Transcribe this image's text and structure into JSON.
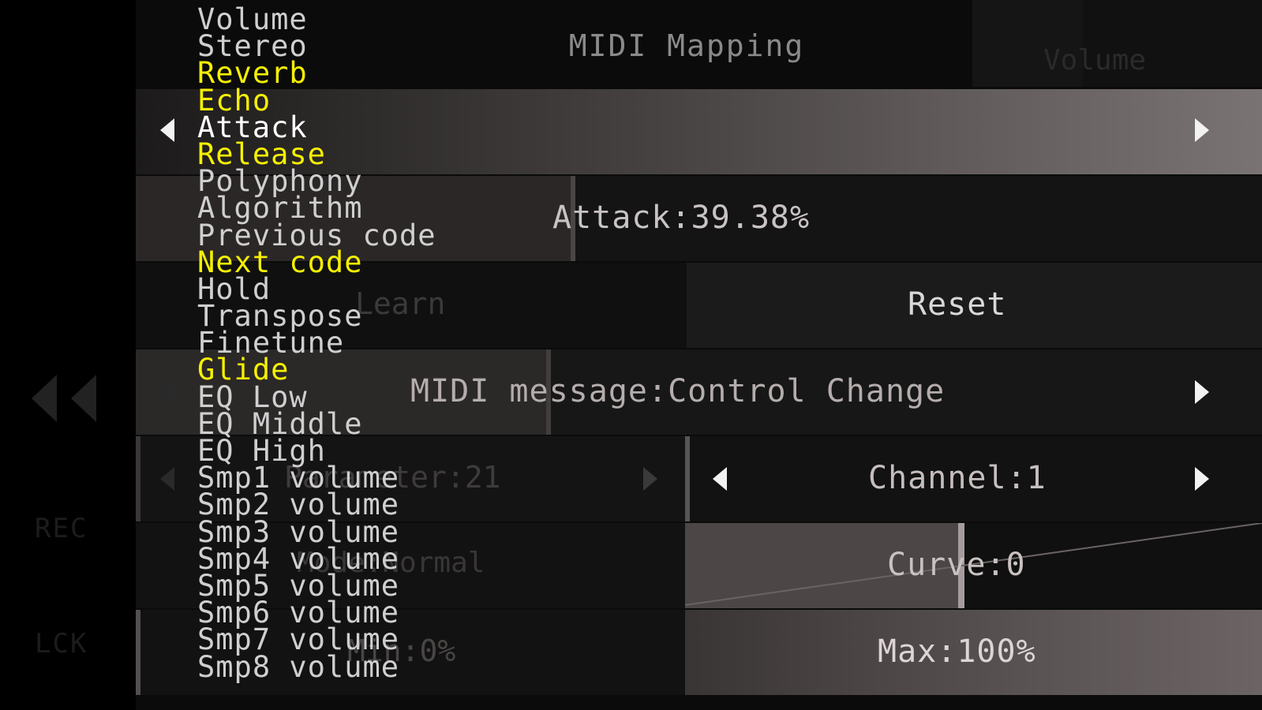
{
  "title": "MIDI Mapping",
  "left_panel": {
    "rec_label": "REC",
    "lck_label": "LCK"
  },
  "ghost_column": [
    "Volume",
    "Stereo",
    "Reverb",
    "Echo",
    "Attack",
    "Release"
  ],
  "parameter_list": {
    "selected": "Attack",
    "items": [
      {
        "label": "Volume",
        "mapped": false
      },
      {
        "label": "Stereo",
        "mapped": false
      },
      {
        "label": "Reverb",
        "mapped": true
      },
      {
        "label": "Echo",
        "mapped": true
      },
      {
        "label": "Attack",
        "mapped": false,
        "selected": true
      },
      {
        "label": "Release",
        "mapped": true
      },
      {
        "label": "Polyphony",
        "mapped": false
      },
      {
        "label": "Algorithm",
        "mapped": false
      },
      {
        "label": "Previous code",
        "mapped": false
      },
      {
        "label": "Next code",
        "mapped": true
      },
      {
        "label": "Hold",
        "mapped": false
      },
      {
        "label": "Transpose",
        "mapped": false
      },
      {
        "label": "Finetune",
        "mapped": false
      },
      {
        "label": "Glide",
        "mapped": true
      },
      {
        "label": "EQ Low",
        "mapped": false
      },
      {
        "label": "EQ Middle",
        "mapped": false
      },
      {
        "label": "EQ High",
        "mapped": false
      },
      {
        "label": "Smp1 volume",
        "mapped": false
      },
      {
        "label": "Smp2 volume",
        "mapped": false
      },
      {
        "label": "Smp3 volume",
        "mapped": false
      },
      {
        "label": "Smp4 volume",
        "mapped": false
      },
      {
        "label": "Smp5 volume",
        "mapped": false
      },
      {
        "label": "Smp6 volume",
        "mapped": false
      },
      {
        "label": "Smp7 volume",
        "mapped": false
      },
      {
        "label": "Smp8 volume",
        "mapped": false
      }
    ]
  },
  "attack": {
    "label": "Attack:39.38%",
    "value_fraction": 0.3938
  },
  "learn_label": "Learn",
  "reset_label": "Reset",
  "midi_message": {
    "label": "MIDI message:Control Change"
  },
  "parameter": {
    "label": "Parameter:21"
  },
  "channel": {
    "label": "Channel:1"
  },
  "mode": {
    "label": "Mode:Normal"
  },
  "curve": {
    "label": "Curve:0"
  },
  "min": {
    "label": "Min:0%",
    "value_fraction": 0.0
  },
  "max": {
    "label": "Max:100%",
    "value_fraction": 1.0
  },
  "colors": {
    "mapped_item": "#f5f000",
    "unmapped_item": "#cfcfcf",
    "selected_item": "#ffffff"
  }
}
